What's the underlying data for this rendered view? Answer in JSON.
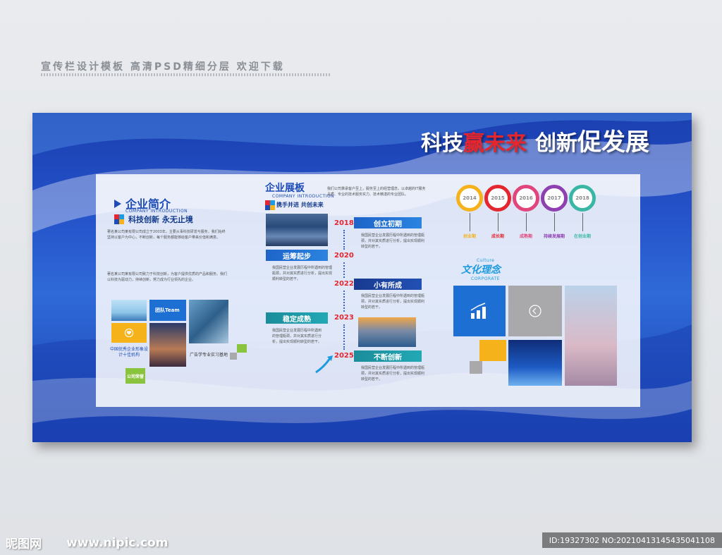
{
  "header": {
    "text": "宣传栏设计模板 高清PSD精细分层 欢迎下载"
  },
  "slogan": {
    "part1_prefix": "科技",
    "part1_red": "赢未来",
    "part2_prefix": "创新",
    "part2_big": "促发展"
  },
  "company_intro": {
    "title": "企业简介",
    "subtitle": "COMPANY INTRODUCTION",
    "tagline": "科技创新 永无止境",
    "paragraph1": "著名某公司某有限公司成立于2003年，主要从事科技研发与服务，我们始终坚持以客户为中心，不断创新，每个服务都能够给客户带来价值和满意。",
    "paragraph2": "著名某公司某有限公司致力于科技创新，为客户提供优质的产品和服务。我们以科技为驱动力，持续创新，努力成为行业领先的企业。",
    "team_label": "团队Team",
    "caption1": "中国优秀企业形象设计十佳机构",
    "caption2": "广告学专业实习基地",
    "honor_label": "公司荣誉"
  },
  "company_board": {
    "title": "企业展板",
    "subtitle": "COMPANY INTRODUCTION",
    "tagline": "携手并进 共创未来",
    "intro_text": "我们公司秉承客户至上，服务至上的经营理念，以卓越的IT服务品质、专业的技术服务实力、技术精湛的专业团队。",
    "milestones": [
      {
        "year": "2018",
        "label": "创立初期"
      },
      {
        "year": "2020",
        "label": "运筹起步"
      },
      {
        "year": "2022",
        "label": "小有所成"
      },
      {
        "year": "2023",
        "label": "稳定成熟"
      },
      {
        "year": "2025",
        "label": "不断创新"
      }
    ],
    "body_text": "我国民营企业发展历程中所遇到的管理瓶颈，并对其实质进行分析，提出实现顺利转型的若干。"
  },
  "timeline": {
    "steps": [
      {
        "year": "2014",
        "label": "创业期",
        "color": "#f5b21a"
      },
      {
        "year": "2015",
        "label": "成长期",
        "color": "#e4262e"
      },
      {
        "year": "2016",
        "label": "成熟期",
        "color": "#e0457b"
      },
      {
        "year": "2017",
        "label": "持续发展期",
        "color": "#8e3fb0"
      },
      {
        "year": "2018",
        "label": "在创业期",
        "color": "#3ab7a4"
      }
    ]
  },
  "culture": {
    "title": "文化理念",
    "prefix": "Culture",
    "subtitle": "CORPORATE"
  },
  "footer": {
    "logo": "昵图网",
    "url": "www.nipic.com",
    "id": "ID:19327302 NO:20210413145435041108"
  }
}
